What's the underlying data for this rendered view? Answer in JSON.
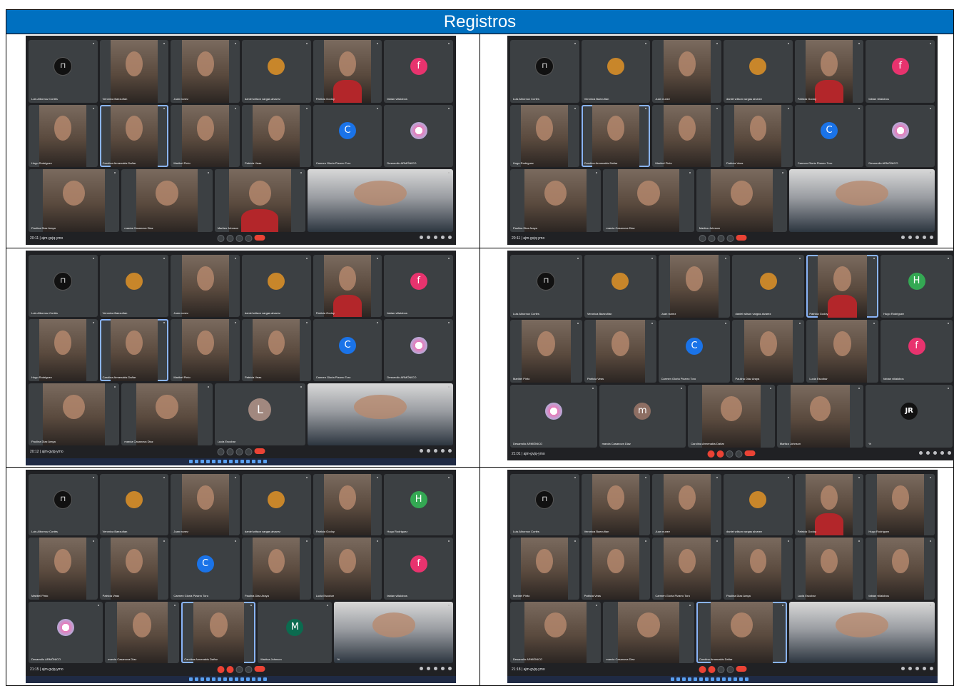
{
  "header": {
    "title": "Registros"
  },
  "screens": [
    {
      "meeting": "20:11 | ajm-gvjq-ymo",
      "taskbar": false,
      "rows": [
        [
          {
            "name": "Luis Albornoz Cortés",
            "avatar": "lock"
          },
          {
            "name": "Veronica Baezuñan",
            "photo": true
          },
          {
            "name": "Juan nunez",
            "photo": true
          },
          {
            "name": "daniel wilson vargas alvarez",
            "avatar": "orange"
          },
          {
            "name": "Patricia Godoy",
            "photo": true,
            "red": true
          },
          {
            "name": "fabian villalobos",
            "avatar": "f",
            "letter": "f"
          }
        ],
        [
          {
            "name": "Hugo Rodriguez",
            "photo": true
          },
          {
            "name": "Carolina Armenakis Dañar",
            "photo": true,
            "active": true
          },
          {
            "name": "Maribel Pinto",
            "photo": true
          },
          {
            "name": "Patricia Veas",
            "photo": true
          },
          {
            "name": "Carmen Gloria Pizarro Toro",
            "avatar": "c",
            "letter": "C"
          },
          {
            "name": "Desarrollo ARMÓNICO",
            "avatar": "ring"
          }
        ],
        [
          {
            "name": "Paulina Diaz Araya",
            "photo": true
          },
          {
            "name": "marcia Casanova Diaz",
            "photo": true
          },
          {
            "name": "Maritza Johnson",
            "photo": true,
            "red": true
          },
          {
            "name": "",
            "photo": true,
            "wide": true
          }
        ]
      ]
    },
    {
      "meeting": "20:11 | ajm-gvjq-ymo",
      "taskbar": false,
      "rows": [
        [
          {
            "name": "Luis Albornoz Cortés",
            "avatar": "lock"
          },
          {
            "name": "Veronica Baezuñan",
            "avatar": "orange"
          },
          {
            "name": "Juan nunez",
            "photo": true
          },
          {
            "name": "daniel wilson vargas alvarez",
            "avatar": "orange"
          },
          {
            "name": "Patricia Godoy",
            "photo": true,
            "red": true
          },
          {
            "name": "fabian villalobos",
            "avatar": "f",
            "letter": "f"
          }
        ],
        [
          {
            "name": "Hugo Rodriguez",
            "photo": true
          },
          {
            "name": "Carolina Armenakis Dañar",
            "photo": true,
            "active": true
          },
          {
            "name": "Maribel Pinto",
            "photo": true
          },
          {
            "name": "Patricia Veas",
            "photo": true
          },
          {
            "name": "Carmen Gloria Pizarro Toro",
            "avatar": "c",
            "letter": "C"
          },
          {
            "name": "Desarrollo ARMÓNICO",
            "avatar": "ring"
          }
        ],
        [
          {
            "name": "Paulina Diaz Araya",
            "photo": true
          },
          {
            "name": "marcia Casanova Diaz",
            "photo": true
          },
          {
            "name": "Maritza Johnson",
            "photo": true
          },
          {
            "name": "",
            "photo": true,
            "wide": true
          }
        ]
      ]
    },
    {
      "meeting": "20:12 | ajm-gvjq-ymo",
      "taskbar": true,
      "rows": [
        [
          {
            "name": "Luis Albornoz Cortés",
            "avatar": "lock"
          },
          {
            "name": "Veronica Baezuñan",
            "avatar": "orange"
          },
          {
            "name": "Juan nunez",
            "photo": true
          },
          {
            "name": "daniel wilson vargas alvarez",
            "avatar": "orange"
          },
          {
            "name": "Patricia Godoy",
            "photo": true,
            "red": true
          },
          {
            "name": "fabian villalobos",
            "avatar": "f",
            "letter": "f"
          }
        ],
        [
          {
            "name": "Hugo Rodriguez",
            "photo": true
          },
          {
            "name": "Carolina Armenakis Dañar",
            "photo": true,
            "active": true
          },
          {
            "name": "Maribel Pinto",
            "photo": true
          },
          {
            "name": "Patricia Veas",
            "photo": true
          },
          {
            "name": "Carmen Gloria Pizarro Toro",
            "avatar": "c",
            "letter": "C"
          },
          {
            "name": "Desarrollo ARMÓNICO",
            "avatar": "ring"
          }
        ],
        [
          {
            "name": "Paulina Diaz Araya",
            "photo": true
          },
          {
            "name": "marcia Casanova Diaz",
            "photo": true
          },
          {
            "name": "Lucia Escobar",
            "avatar": "l",
            "letter": "L"
          },
          {
            "name": "",
            "photo": true,
            "wide": true
          }
        ]
      ]
    },
    {
      "meeting": "21:01 | ajm-gvjq-ymo",
      "taskbar": false,
      "muted": true,
      "rows": [
        [
          {
            "name": "Luis Albornoz Cortés",
            "avatar": "lock"
          },
          {
            "name": "Veronica Baezuñan",
            "avatar": "orange"
          },
          {
            "name": "Juan nunez",
            "photo": true
          },
          {
            "name": "daniel wilson vargas alvarez",
            "avatar": "orange"
          },
          {
            "name": "Patricia Godoy",
            "photo": true,
            "red": true,
            "active": true
          },
          {
            "name": "Hugo Rodriguez",
            "avatar": "h",
            "letter": "H"
          }
        ],
        [
          {
            "name": "Maribel Pinto",
            "photo": true
          },
          {
            "name": "Patricia Veas",
            "photo": true
          },
          {
            "name": "Carmen Gloria Pizarro Toro",
            "avatar": "c",
            "letter": "C"
          },
          {
            "name": "Paulina Diaz Araya",
            "photo": true
          },
          {
            "name": "Lucia Escobar",
            "photo": true
          },
          {
            "name": "fabian villalobos",
            "avatar": "f",
            "letter": "f"
          }
        ],
        [
          {
            "name": "Desarrollo ARMÓNICO",
            "avatar": "ring"
          },
          {
            "name": "marcia Casanova Diaz",
            "avatar": "m",
            "letter": "m"
          },
          {
            "name": "Carolina Armenakis Dañar",
            "photo": true
          },
          {
            "name": "Maritza Johnson",
            "photo": true
          },
          {
            "name": "%",
            "avatar": "jr",
            "letter": "JR"
          }
        ]
      ]
    },
    {
      "meeting": "21:15 | ajm-gvjq-ymo",
      "taskbar": true,
      "muted": true,
      "rows": [
        [
          {
            "name": "Luis Albornoz Cortés",
            "avatar": "lock"
          },
          {
            "name": "Veronica Baezuñan",
            "avatar": "orange"
          },
          {
            "name": "Juan nunez",
            "photo": true
          },
          {
            "name": "daniel wilson vargas alvarez",
            "avatar": "orange"
          },
          {
            "name": "Patricia Godoy",
            "photo": true
          },
          {
            "name": "Hugo Rodriguez",
            "avatar": "h",
            "letter": "H"
          }
        ],
        [
          {
            "name": "Maribel Pinto",
            "photo": true
          },
          {
            "name": "Patricia Veas",
            "photo": true
          },
          {
            "name": "Carmen Gloria Pizarro Toro",
            "avatar": "c",
            "letter": "C"
          },
          {
            "name": "Paulina Diaz Araya",
            "photo": true
          },
          {
            "name": "Lucia Escobar",
            "photo": true
          },
          {
            "name": "fabian villalobos",
            "avatar": "f",
            "letter": "f"
          }
        ],
        [
          {
            "name": "Desarrollo ARMÓNICO",
            "avatar": "ring"
          },
          {
            "name": "marcia Casanova Diaz",
            "photo": true
          },
          {
            "name": "Carolina Armenakis Dañar",
            "photo": true,
            "active": true
          },
          {
            "name": "Maritza Johnson",
            "avatar": "M",
            "letter": "M"
          },
          {
            "name": "%",
            "photo": true,
            "wide": true
          }
        ]
      ]
    },
    {
      "meeting": "21:18 | ajm-gvjq-ymo",
      "taskbar": true,
      "muted": true,
      "rows": [
        [
          {
            "name": "Luis Albornoz Cortés",
            "avatar": "lock"
          },
          {
            "name": "Veronica Baezuñan",
            "photo": true
          },
          {
            "name": "Juan nunez",
            "photo": true
          },
          {
            "name": "daniel wilson vargas alvarez",
            "avatar": "orange"
          },
          {
            "name": "Patricia Godoy",
            "photo": true,
            "red": true
          },
          {
            "name": "Hugo Rodriguez",
            "photo": true
          }
        ],
        [
          {
            "name": "Maribel Pinto",
            "photo": true
          },
          {
            "name": "Patricia Veas",
            "photo": true
          },
          {
            "name": "Carmen Gloria Pizarro Toro",
            "photo": true
          },
          {
            "name": "Paulina Diaz Araya",
            "photo": true
          },
          {
            "name": "Lucia Escobar",
            "photo": true
          },
          {
            "name": "fabian villalobos",
            "photo": true
          }
        ],
        [
          {
            "name": "Desarrollo ARMÓNICO",
            "photo": true
          },
          {
            "name": "marcia Casanova Diaz",
            "photo": true
          },
          {
            "name": "Carolina Armenakis Dañar",
            "photo": true,
            "active": true
          },
          {
            "name": "",
            "photo": true,
            "wide": true
          }
        ]
      ]
    }
  ]
}
